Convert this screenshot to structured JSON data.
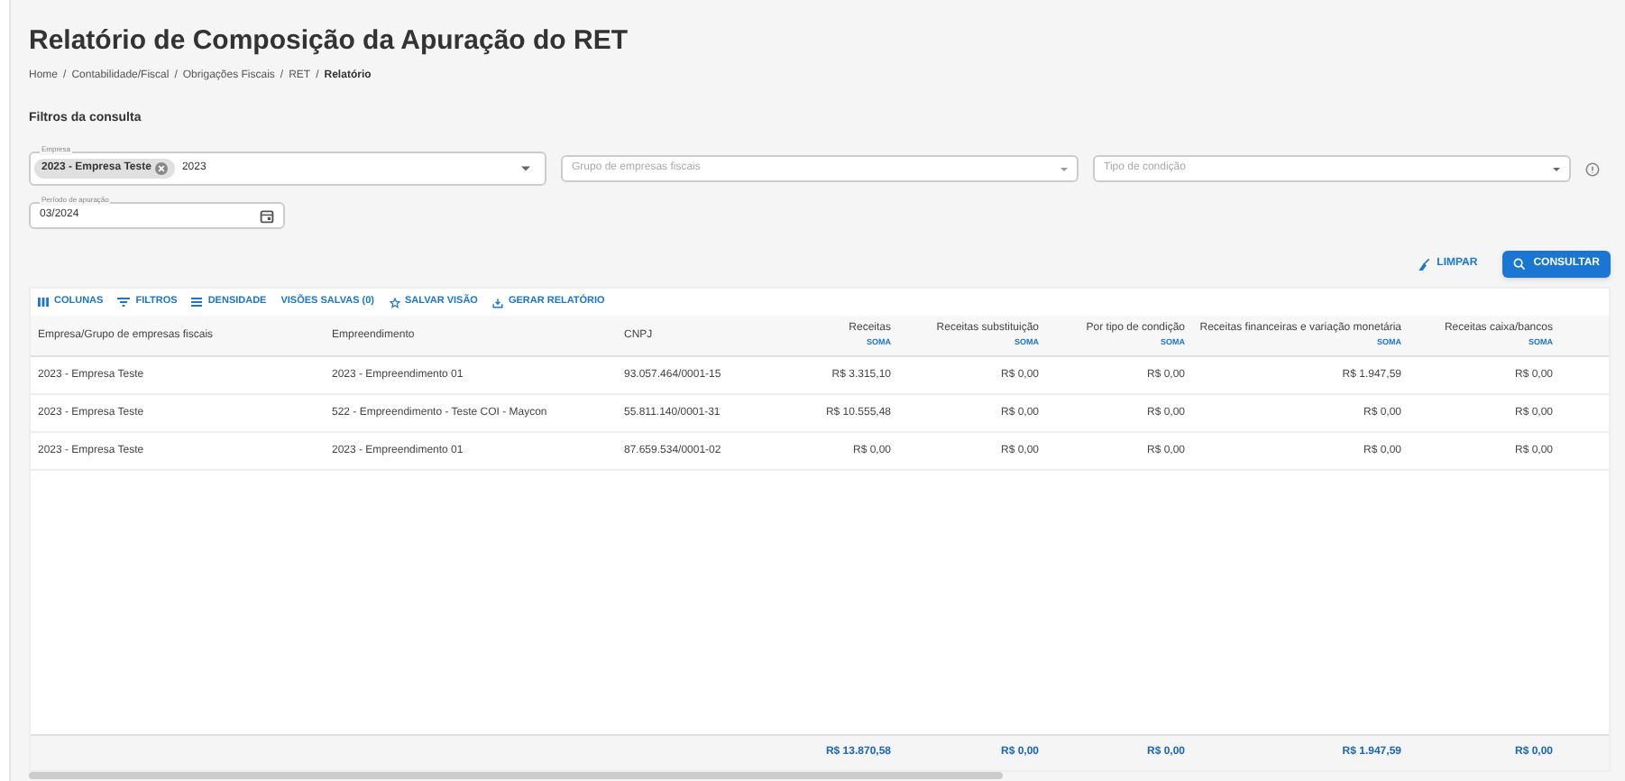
{
  "title": "Relatório de Composição da Apuração do RET",
  "breadcrumb": [
    {
      "label": "Home",
      "current": false
    },
    {
      "label": "Contabilidade/Fiscal",
      "current": false
    },
    {
      "label": "Obrigações Fiscais",
      "current": false
    },
    {
      "label": "RET",
      "current": false
    },
    {
      "label": "Relatório",
      "current": true
    }
  ],
  "breadcrumb_separator": "/",
  "filters_heading": "Filtros da consulta",
  "empresa_field": {
    "label": "Empresa",
    "chip": "2023 - Empresa Teste",
    "value": "2023"
  },
  "grupo_field": {
    "placeholder": "Grupo de empresas fiscais"
  },
  "tipo_field": {
    "placeholder": "Tipo de condição"
  },
  "periodo_field": {
    "label": "Período de apuração",
    "value": "03/2024"
  },
  "actions": [
    {
      "kind": "text",
      "label": "LIMPAR"
    },
    {
      "kind": "primary",
      "label": "CONSULTAR"
    }
  ],
  "toolbar": [
    {
      "kind": "columns",
      "label": "COLUNAS"
    },
    {
      "kind": "filter",
      "label": "FILTROS"
    },
    {
      "kind": "density",
      "label": "DENSIDADE"
    },
    {
      "kind": "none",
      "label": "VISÕES SALVAS (0)"
    },
    {
      "kind": "star",
      "label": "SALVAR VISÃO"
    },
    {
      "kind": "download",
      "label": "GERAR RELATÓRIO"
    }
  ],
  "table": {
    "columns": [
      {
        "label": "Empresa/Grupo de empresas fiscais",
        "kind": "text"
      },
      {
        "label": "Empreendimento",
        "kind": "text"
      },
      {
        "label": "CNPJ",
        "kind": "text"
      },
      {
        "label": "Receitas",
        "kind": "amount",
        "aggregate": "SOMA"
      },
      {
        "label": "Receitas substituição",
        "kind": "amount",
        "aggregate": "SOMA"
      },
      {
        "label": "Por tipo de condição",
        "kind": "amount",
        "aggregate": "SOMA"
      },
      {
        "label": "Receitas financeiras e variação monetária",
        "kind": "amount",
        "aggregate": "SOMA"
      },
      {
        "label": "Receitas caixa/bancos",
        "kind": "amount",
        "aggregate": "SOMA"
      }
    ],
    "rows": [
      [
        "2023 - Empresa Teste",
        "2023 - Empreendimento 01",
        "93.057.464/0001-15",
        "R$ 3.315,10",
        "R$ 0,00",
        "R$ 0,00",
        "R$ 1.947,59",
        "R$ 0,00"
      ],
      [
        "2023 - Empresa Teste",
        "522 - Empreendimento - Teste COI - Maycon",
        "55.811.140/0001-31",
        "R$ 10.555,48",
        "R$ 0,00",
        "R$ 0,00",
        "R$ 0,00",
        "R$ 0,00"
      ],
      [
        "2023 - Empresa Teste",
        "2023 - Empreendimento 01",
        "87.659.534/0001-02",
        "R$ 0,00",
        "R$ 0,00",
        "R$ 0,00",
        "R$ 0,00",
        "R$ 0,00"
      ]
    ],
    "totals": [
      "R$ 13.870,58",
      "R$ 0,00",
      "R$ 0,00",
      "R$ 1.947,59",
      "R$ 0,00"
    ]
  }
}
